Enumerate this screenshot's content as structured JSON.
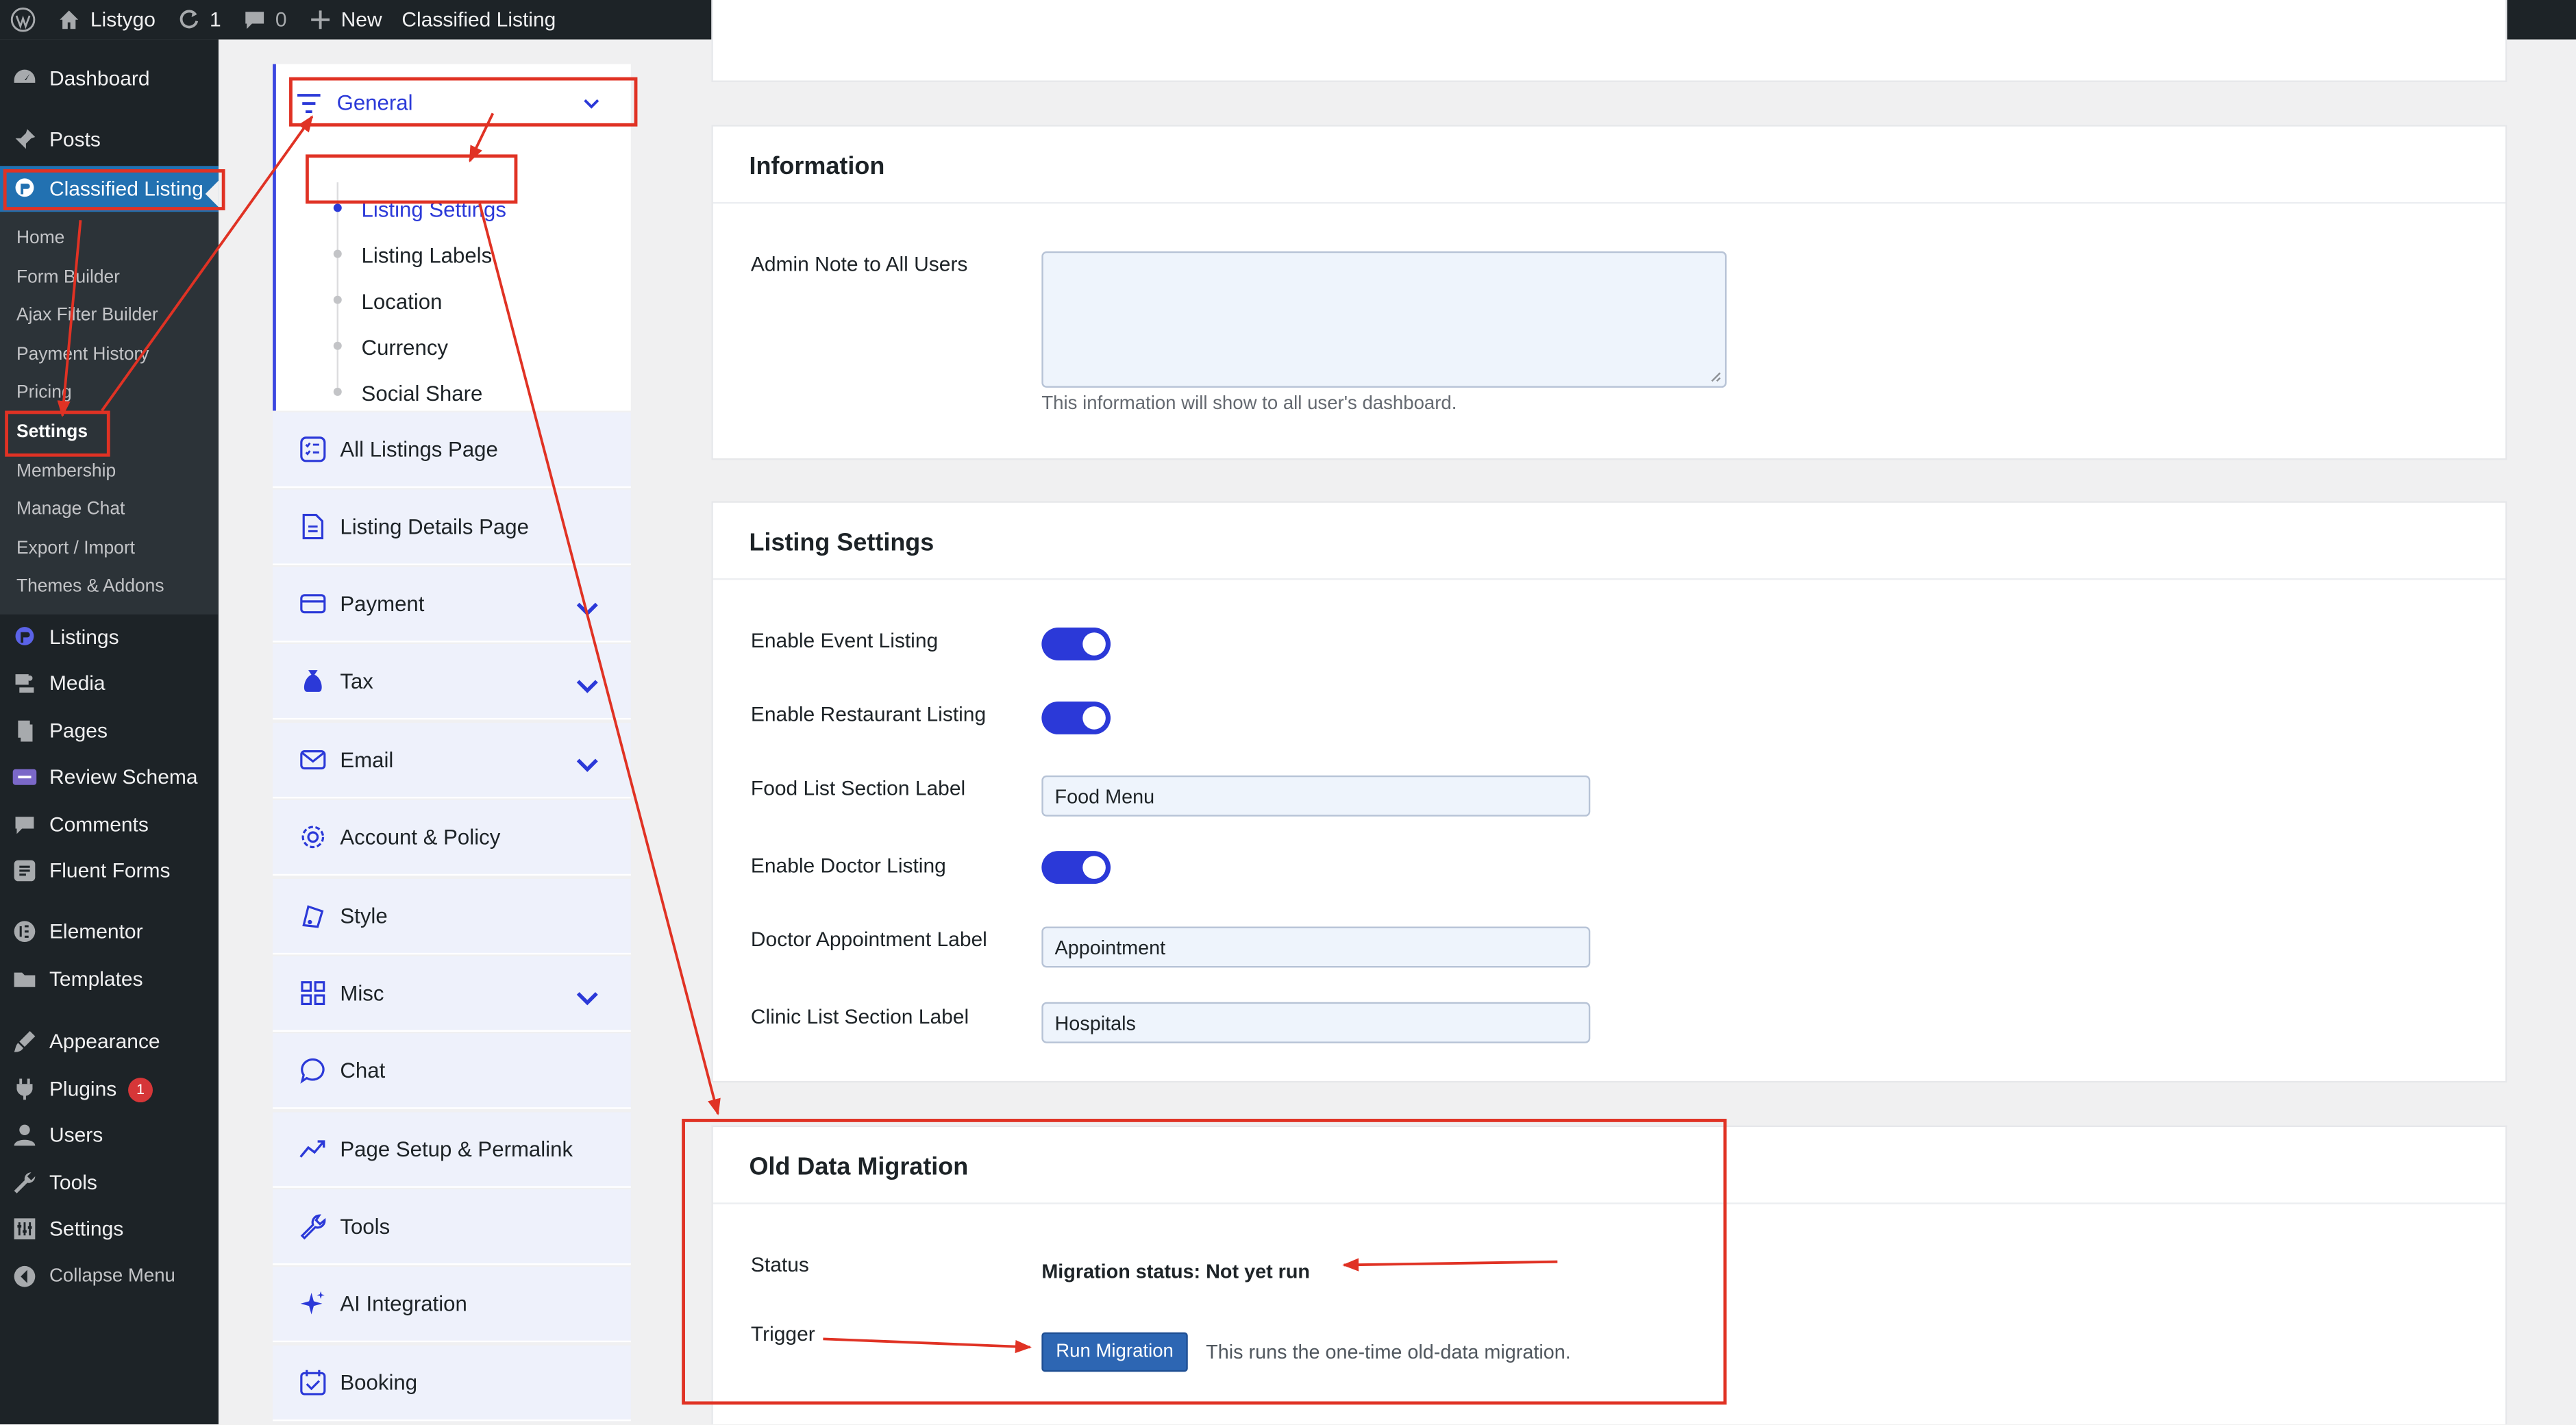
{
  "adminbar": {
    "site_name": "Listygo",
    "updates_count": "1",
    "comments_count": "0",
    "new_label": "New",
    "plugin_label": "Classified Listing"
  },
  "admin_menu": {
    "items": [
      {
        "label": "Dashboard",
        "icon": "dashboard-icon"
      },
      {
        "label": "Posts",
        "icon": "pin-icon"
      },
      {
        "label": "Classified Listing",
        "icon": "classified-listing-icon"
      },
      {
        "label": "Listings",
        "icon": "listings-icon"
      },
      {
        "label": "Media",
        "icon": "media-icon"
      },
      {
        "label": "Pages",
        "icon": "pages-icon"
      },
      {
        "label": "Review Schema",
        "icon": "review-schema-icon"
      },
      {
        "label": "Comments",
        "icon": "comment-icon"
      },
      {
        "label": "Fluent Forms",
        "icon": "form-icon"
      },
      {
        "label": "Elementor",
        "icon": "elementor-icon"
      },
      {
        "label": "Templates",
        "icon": "folder-icon"
      },
      {
        "label": "Appearance",
        "icon": "brush-icon"
      },
      {
        "label": "Plugins",
        "icon": "plugin-icon"
      },
      {
        "label": "Users",
        "icon": "user-icon"
      },
      {
        "label": "Tools",
        "icon": "wrench-icon"
      },
      {
        "label": "Settings",
        "icon": "settings-icon"
      },
      {
        "label": "Collapse Menu",
        "icon": "collapse-icon"
      }
    ],
    "plugins_badge": "1",
    "submenu": [
      "Home",
      "Form Builder",
      "Ajax Filter Builder",
      "Payment History",
      "Pricing",
      "Settings",
      "Membership",
      "Manage Chat",
      "Export / Import",
      "Themes & Addons"
    ]
  },
  "settings_nav": {
    "general": {
      "label": "General",
      "children": [
        "Listing Settings",
        "Listing Labels",
        "Location",
        "Currency",
        "Social Share"
      ]
    },
    "items": [
      {
        "label": "All Listings Page",
        "icon": "list-check-icon",
        "chevron": false
      },
      {
        "label": "Listing Details Page",
        "icon": "document-icon",
        "chevron": false
      },
      {
        "label": "Payment",
        "icon": "credit-card-icon",
        "chevron": true
      },
      {
        "label": "Tax",
        "icon": "tax-bag-icon",
        "chevron": true
      },
      {
        "label": "Email",
        "icon": "email-icon",
        "chevron": true
      },
      {
        "label": "Account & Policy",
        "icon": "gear-icon",
        "chevron": false
      },
      {
        "label": "Style",
        "icon": "style-icon",
        "chevron": false
      },
      {
        "label": "Misc",
        "icon": "grid-icon",
        "chevron": true
      },
      {
        "label": "Chat",
        "icon": "chat-icon",
        "chevron": false
      },
      {
        "label": "Page Setup & Permalink",
        "icon": "trend-icon",
        "chevron": false
      },
      {
        "label": "Tools",
        "icon": "wrench-icon",
        "chevron": false
      },
      {
        "label": "AI Integration",
        "icon": "sparkle-icon",
        "chevron": false
      },
      {
        "label": "Booking",
        "icon": "calendar-icon",
        "chevron": false
      }
    ]
  },
  "information": {
    "title": "Information",
    "admin_note_label": "Admin Note to All Users",
    "admin_note_value": "",
    "admin_note_hint": "This information will show to all user's dashboard."
  },
  "listing_settings": {
    "title": "Listing Settings",
    "event_label": "Enable Event Listing",
    "restaurant_label": "Enable Restaurant Listing",
    "food_label": "Food List Section Label",
    "food_value": "Food Menu",
    "doctor_label": "Enable Doctor Listing",
    "appointment_label": "Doctor Appointment Label",
    "appointment_value": "Appointment",
    "clinic_label": "Clinic List Section Label",
    "clinic_value": "Hospitals"
  },
  "migration": {
    "title": "Old Data Migration",
    "status_label": "Status",
    "status_value": "Migration status: Not yet run",
    "trigger_label": "Trigger",
    "button_label": "Run Migration",
    "note": "This runs the one-time old-data migration."
  },
  "colors": {
    "accent": "#2b39d8",
    "admin_dark": "#1d2327",
    "wp_blue": "#2271b1",
    "annotation_red": "#e03224"
  }
}
